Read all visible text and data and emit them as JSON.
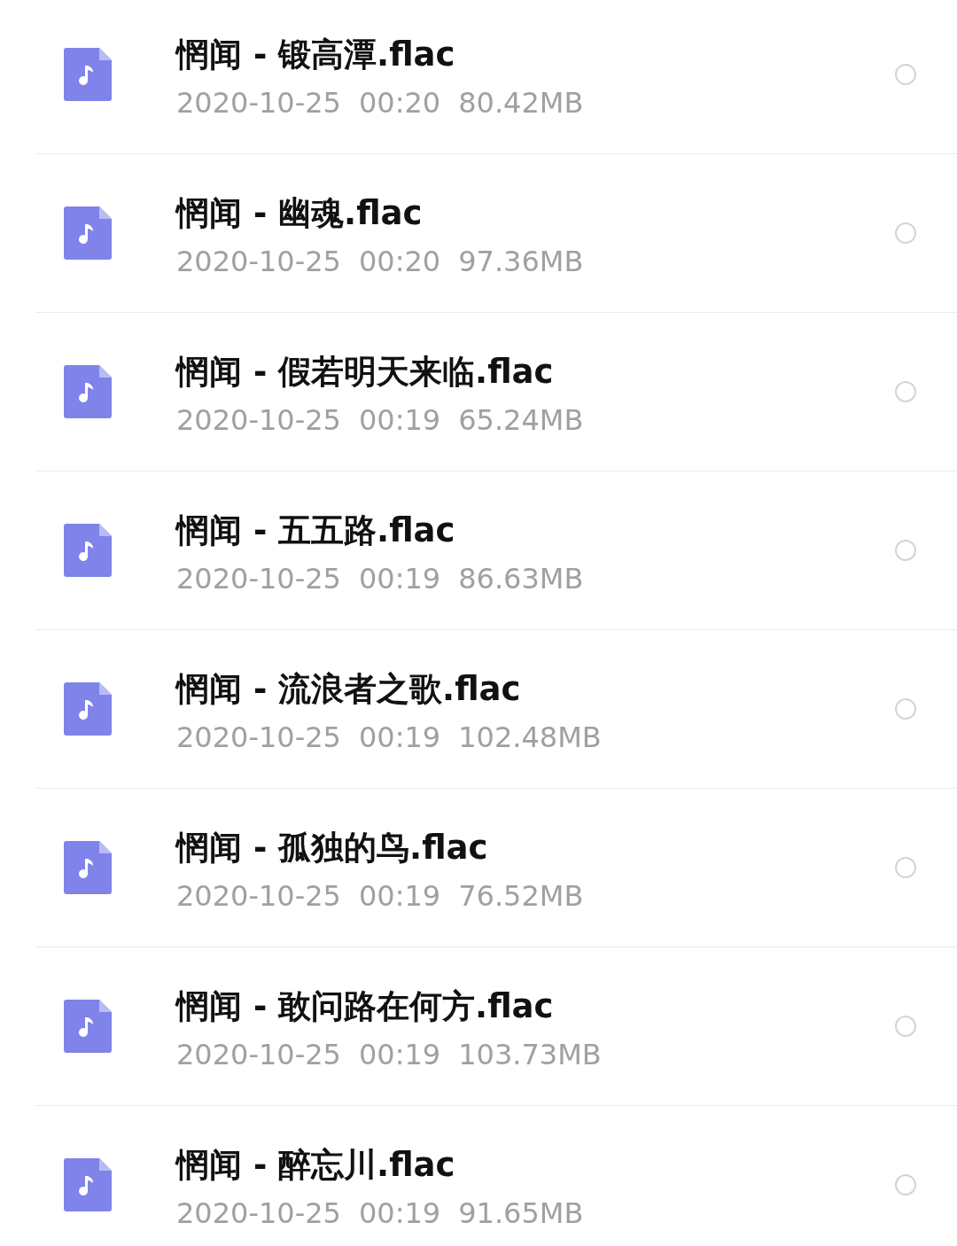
{
  "files": [
    {
      "name": "惘闻 - 锻高潭.flac",
      "date": "2020-10-25",
      "time": "00:20",
      "size": "80.42MB",
      "selected": false
    },
    {
      "name": "惘闻 - 幽魂.flac",
      "date": "2020-10-25",
      "time": "00:20",
      "size": "97.36MB",
      "selected": false
    },
    {
      "name": "惘闻 - 假若明天来临.flac",
      "date": "2020-10-25",
      "time": "00:19",
      "size": "65.24MB",
      "selected": false
    },
    {
      "name": "惘闻 - 五五路.flac",
      "date": "2020-10-25",
      "time": "00:19",
      "size": "86.63MB",
      "selected": false
    },
    {
      "name": "惘闻 - 流浪者之歌.flac",
      "date": "2020-10-25",
      "time": "00:19",
      "size": "102.48MB",
      "selected": false
    },
    {
      "name": "惘闻 - 孤独的鸟.flac",
      "date": "2020-10-25",
      "time": "00:19",
      "size": "76.52MB",
      "selected": false
    },
    {
      "name": "惘闻 - 敢问路在何方.flac",
      "date": "2020-10-25",
      "time": "00:19",
      "size": "103.73MB",
      "selected": false
    },
    {
      "name": "惘闻 - 醉忘川.flac",
      "date": "2020-10-25",
      "time": "00:19",
      "size": "91.65MB",
      "selected": false
    }
  ]
}
